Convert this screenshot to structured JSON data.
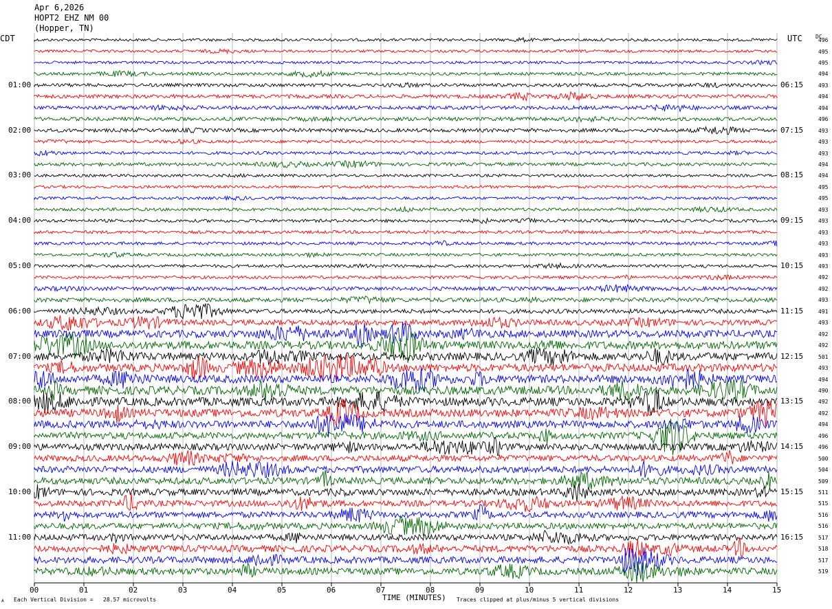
{
  "header": {
    "date": "Apr 6,2026",
    "station": "HOPT2 EHZ NM 00",
    "location": "(Hopper, TN)",
    "left_tz": "CDT",
    "right_tz": "UTC",
    "dc_label": "DC"
  },
  "footer": {
    "scale_text": "Each Vertical Division =   28.57 microvolts",
    "xlabel": "TIME (MINUTES)",
    "clip_text": "Traces clipped at plus/minus 5 vertical divisions",
    "corner_glyph": "A"
  },
  "chart_data": {
    "type": "line",
    "x_ticks": [
      "00",
      "01",
      "02",
      "03",
      "04",
      "05",
      "06",
      "07",
      "08",
      "09",
      "10",
      "11",
      "12",
      "13",
      "14",
      "15"
    ],
    "xlim": [
      0,
      15
    ],
    "trace_colors": [
      "#000000",
      "#ff0000",
      "#0000ff",
      "#006400"
    ],
    "left_hour_labels": [
      "01:00",
      "02:00",
      "03:00",
      "04:00",
      "05:00",
      "06:00",
      "07:00",
      "08:00",
      "09:00",
      "10:00",
      "11:00"
    ],
    "right_hour_labels": [
      "06:15",
      "07:15",
      "08:15",
      "09:15",
      "10:15",
      "11:15",
      "12:15",
      "13:15",
      "14:15",
      "15:15",
      "16:15"
    ],
    "dc_offsets": [
      "496",
      "495",
      "495",
      "494",
      "493",
      "494",
      "494",
      "496",
      "493",
      "493",
      "493",
      "494",
      "494",
      "495",
      "495",
      "493",
      "493",
      "493",
      "493",
      "493",
      "493",
      "492",
      "492",
      "493",
      "491",
      "493",
      "492",
      "492",
      "501",
      "493",
      "494",
      "490",
      "492",
      "492",
      "494",
      "496",
      "496",
      "500",
      "504",
      "509",
      "511",
      "515",
      "516",
      "516",
      "517",
      "518",
      "517",
      "519"
    ],
    "activity": [
      0.15,
      0.15,
      0.15,
      0.2,
      0.25,
      0.3,
      0.3,
      0.3,
      0.3,
      0.2,
      0.2,
      0.25,
      0.15,
      0.15,
      0.15,
      0.2,
      0.2,
      0.2,
      0.2,
      0.2,
      0.2,
      0.2,
      0.3,
      0.4,
      0.4,
      0.6,
      0.9,
      1.0,
      1.0,
      1.0,
      1.0,
      1.1,
      1.1,
      1.0,
      0.9,
      0.8,
      0.8,
      0.7,
      0.8,
      0.8,
      0.8,
      0.7,
      0.7,
      0.7,
      0.7,
      0.8,
      0.8,
      0.8
    ]
  }
}
